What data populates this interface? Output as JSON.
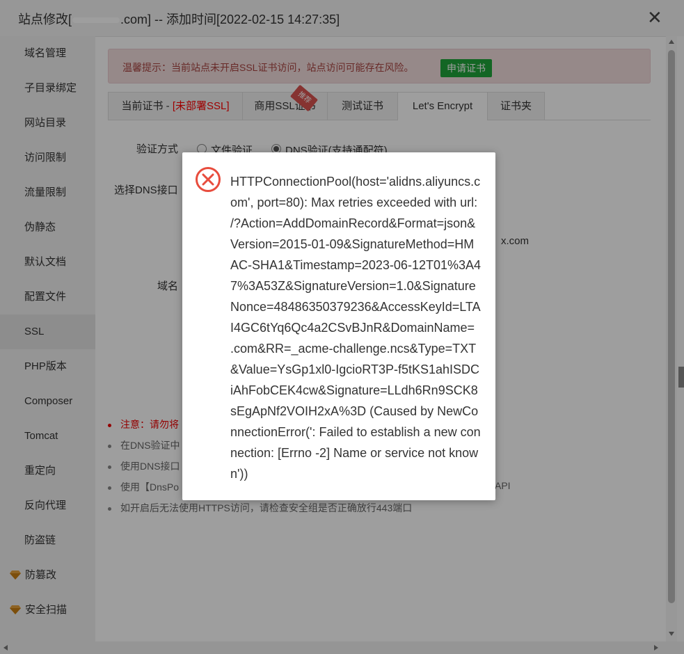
{
  "window": {
    "title_prefix": "站点修改[",
    "title_suffix": ".com] -- 添加时间[2022-02-15 14:27:35]",
    "close_glyph": "✕"
  },
  "sidebar": {
    "items": [
      {
        "label": "域名管理"
      },
      {
        "label": "子目录绑定"
      },
      {
        "label": "网站目录"
      },
      {
        "label": "访问限制"
      },
      {
        "label": "流量限制"
      },
      {
        "label": "伪静态"
      },
      {
        "label": "默认文档"
      },
      {
        "label": "配置文件"
      },
      {
        "label": "SSL"
      },
      {
        "label": "PHP版本"
      },
      {
        "label": "Composer"
      },
      {
        "label": "Tomcat"
      },
      {
        "label": "重定向"
      },
      {
        "label": "反向代理"
      },
      {
        "label": "防盗链"
      },
      {
        "label": "防篡改"
      },
      {
        "label": "安全扫描"
      }
    ],
    "active_label": "SSL",
    "gem_color": "#e6a23c"
  },
  "alert": {
    "text": "温馨提示：当前站点未开启SSL证书访问，站点访问可能存在风险。",
    "button": "申请证书"
  },
  "tabs": {
    "current_cert_prefix": "当前证书 - ",
    "current_cert_status": "[未部署SSL]",
    "commercial": "商用SSL证书",
    "ribbon": "推荐",
    "test": "测试证书",
    "letsencrypt": "Let's Encrypt",
    "folder": "证书夹"
  },
  "form": {
    "verify_label": "验证方式",
    "option_file": "文件验证",
    "option_dns": "DNS验证(支持通配符)",
    "dns_api_label": "选择DNS接口",
    "domain_label": "域名",
    "partial_domain": "x.com"
  },
  "notes": [
    {
      "text": "注意：请勿将",
      "warn": true
    },
    {
      "text": "在DNS验证中",
      "warn": false
    },
    {
      "text": "使用DNS接口",
      "warn": false
    },
    {
      "text": "使用【DnsPo",
      "warn": false,
      "tail": "API"
    },
    {
      "text": "如开启后无法使用HTTPS访问，请检查安全组是否正确放行443端口",
      "warn": false
    }
  ],
  "dialog": {
    "icon": "error-circle-icon",
    "icon_color": "#e84c3d",
    "message": "HTTPConnectionPool(host='alidns.aliyuncs.com', port=80): Max retries exceeded with url: /?Action=AddDomainRecord&Format=json&Version=2015-01-09&SignatureMethod=HMAC-SHA1&Timestamp=2023-06-12T01%3A47%3A53Z&SignatureVersion=1.0&SignatureNonce=48486350379236&AccessKeyId=LTAI4GC6tYq6Qc4a2CSvBJnR&DomainName=           .com&RR=_acme-challenge.ncs&Type=TXT&Value=YsGp1xl0-IgcioRT3P-f5tKS1ahISDCiAhFobCEK4cw&Signature=LLdh6Rn9SCK8sEgApNf2VOIH2xA%3D (Caused by NewConnectionError(': Failed to establish a new connection: [Errno -2] Name or service not known'))"
  }
}
